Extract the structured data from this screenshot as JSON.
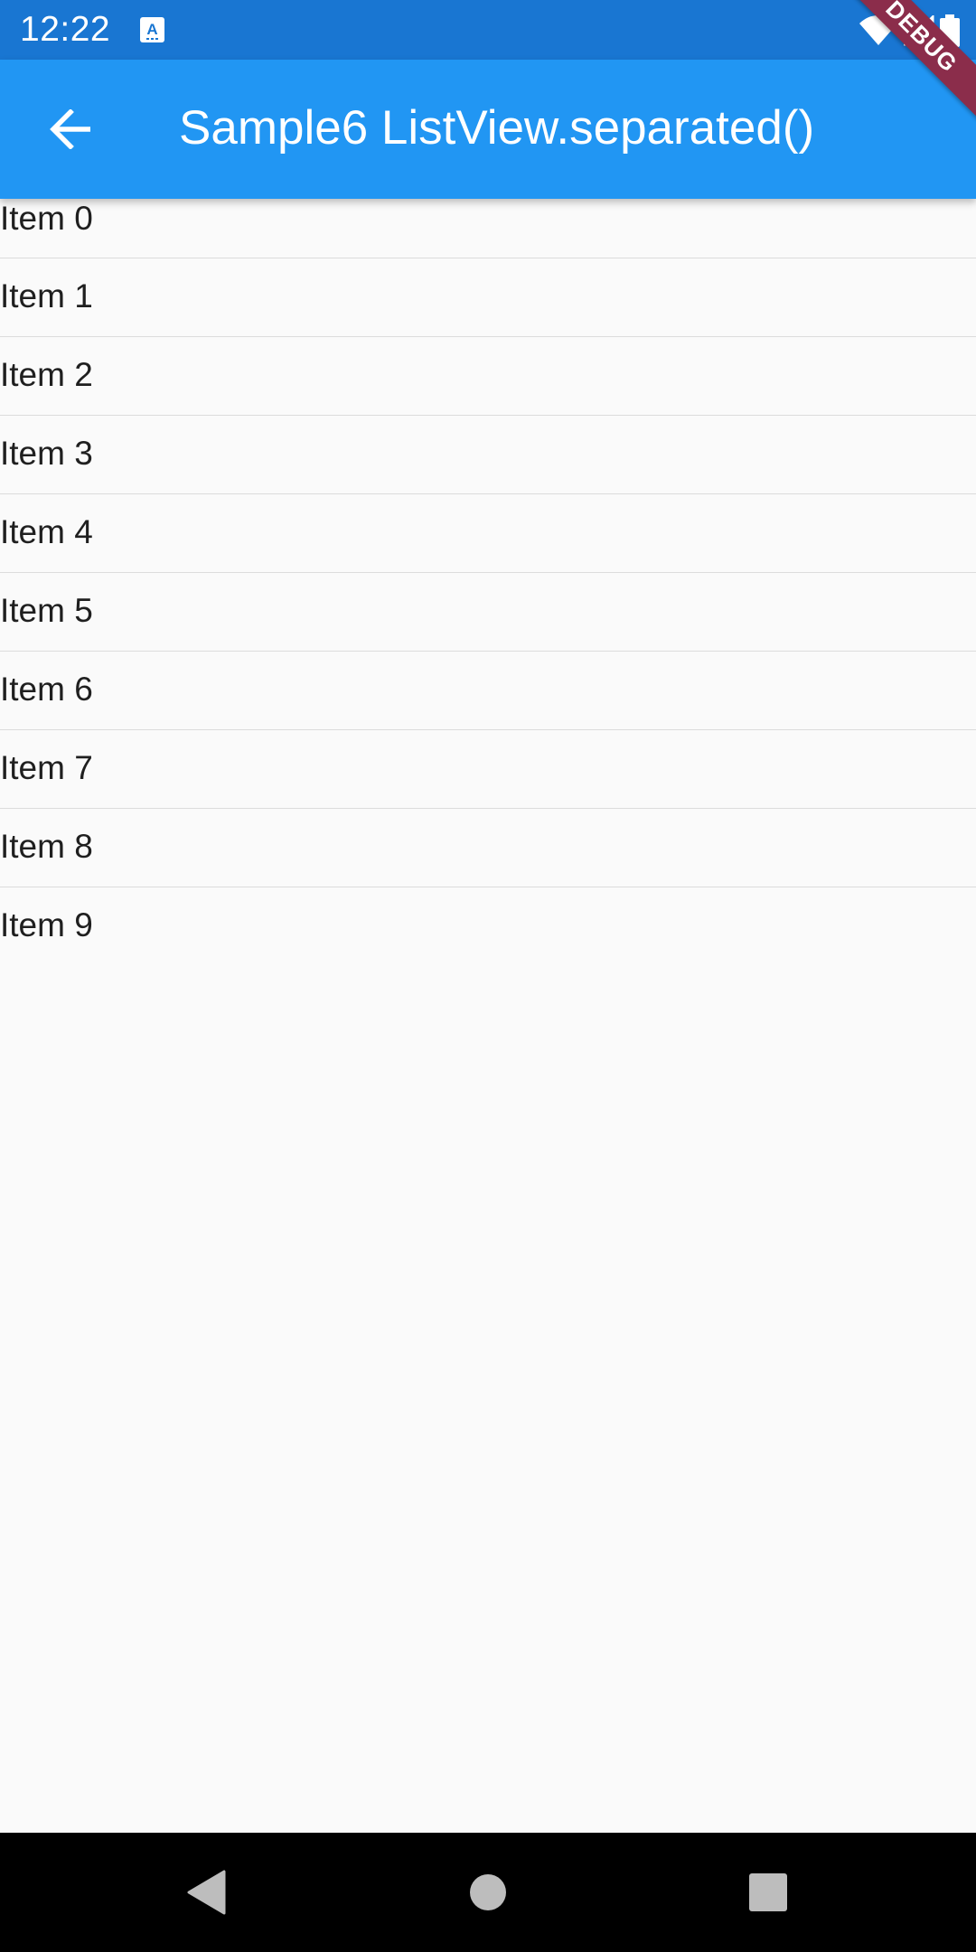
{
  "status_bar": {
    "time": "12:22",
    "notification_icon": "text-a-icon",
    "icons": [
      "wifi-icon",
      "signal-icon",
      "battery-icon"
    ]
  },
  "app_bar": {
    "title": "Sample6 ListView.separated()",
    "back_icon": "arrow-back-icon",
    "color": "#2196f3"
  },
  "debug_banner": {
    "label": "DEBUG"
  },
  "list": {
    "items": [
      {
        "label": "Item 0"
      },
      {
        "label": "Item 1"
      },
      {
        "label": "Item 2"
      },
      {
        "label": "Item 3"
      },
      {
        "label": "Item 4"
      },
      {
        "label": "Item 5"
      },
      {
        "label": "Item 6"
      },
      {
        "label": "Item 7"
      },
      {
        "label": "Item 8"
      },
      {
        "label": "Item 9"
      }
    ]
  },
  "nav_bar": {
    "buttons": [
      "back-triangle-icon",
      "home-circle-icon",
      "recents-square-icon"
    ]
  }
}
